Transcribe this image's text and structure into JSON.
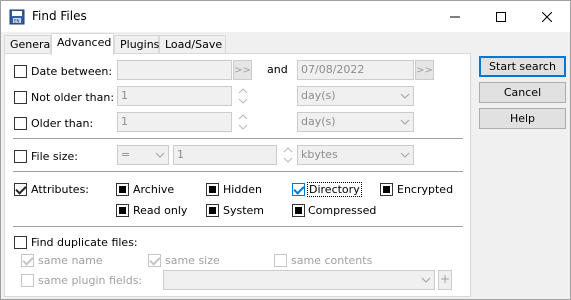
{
  "window": {
    "title": "Find Files",
    "icon": "floppy-disk-icon",
    "controls": [
      "minimize-icon",
      "maximize-icon",
      "close-icon"
    ]
  },
  "tabs": [
    {
      "label": "General",
      "active": false
    },
    {
      "label": "Advanced",
      "active": true
    },
    {
      "label": "Plugins",
      "active": false
    },
    {
      "label": "Load/Save",
      "active": false
    }
  ],
  "date_between": {
    "label": "Date between:",
    "from_value": "",
    "and_label": "and",
    "to_value": "07/08/2022",
    "picker_label": ">>",
    "checked": false
  },
  "not_older_than": {
    "label": "Not older than:",
    "value": "1",
    "unit": "day(s)",
    "checked": false
  },
  "older_than": {
    "label": "Older than:",
    "value": "1",
    "unit": "day(s)",
    "checked": false
  },
  "file_size": {
    "label": "File size:",
    "operator": "=",
    "value": "1",
    "unit": "kbytes",
    "checked": false
  },
  "attributes": {
    "label": "Attributes:",
    "checked": true,
    "items": [
      {
        "label": "Archive",
        "state": "indeterminate"
      },
      {
        "label": "Hidden",
        "state": "indeterminate"
      },
      {
        "label": "Directory",
        "state": "checked"
      },
      {
        "label": "Encrypted",
        "state": "indeterminate"
      },
      {
        "label": "Read only",
        "state": "indeterminate"
      },
      {
        "label": "System",
        "state": "indeterminate"
      },
      {
        "label": "Compressed",
        "state": "indeterminate"
      }
    ]
  },
  "duplicates": {
    "label": "Find duplicate files:",
    "checked": false,
    "same_name": "same name",
    "same_size": "same size",
    "same_contents": "same contents",
    "same_plugin_fields": "same plugin fields:",
    "plus_label": "+"
  },
  "buttons": {
    "start_search": "Start search",
    "cancel": "Cancel",
    "help": "Help"
  },
  "colors": {
    "accent": "#0078d7",
    "disabled_text": "#a0a0a0"
  }
}
